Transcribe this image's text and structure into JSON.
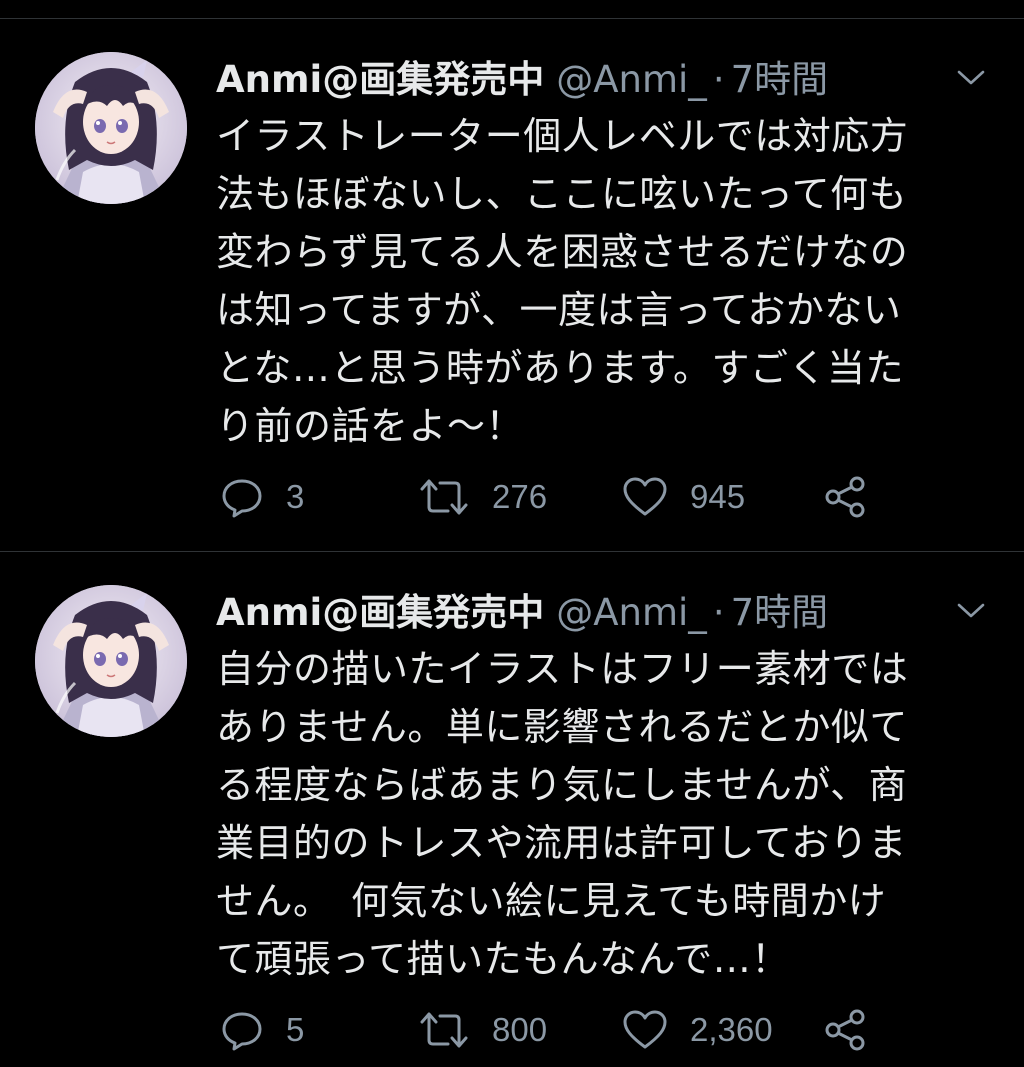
{
  "colors": {
    "background": "#000000",
    "text": "#e7e9ea",
    "secondary_text": "#8b98a5",
    "divider": "#2f3336"
  },
  "tweets": [
    {
      "display_name": "Anmi@画集発売中",
      "handle": "@Anmi_",
      "separator": "·",
      "time": "7時間",
      "text": "イラストレーター個人レベルでは対応方\n法もほぼないし、ここに呟いたって何も\n変わらず見てる人を困惑させるだけなの\nは知ってますが、一度は言っておかない\nとな…と思う時があります。すごく当た\nり前の話をよ〜！",
      "actions": {
        "reply_icon": "comment-icon",
        "reply_count": "3",
        "retweet_icon": "retweet-icon",
        "retweet_count": "276",
        "like_icon": "heart-icon",
        "like_count": "945",
        "share_icon": "share-icon"
      },
      "menu_icon": "chevron-down-icon",
      "avatar": "avatar-illustration"
    },
    {
      "display_name": "Anmi@画集発売中",
      "handle": "@Anmi_",
      "separator": "·",
      "time": "7時間",
      "text": "自分の描いたイラストはフリー素材では\nありません。単に影響されるだとか似て\nる程度ならばあまり気にしませんが、商\n業目的のトレスや流用は許可しておりま\nせん。　何気ない絵に見えても時間かけ\nて頑張って描いたもんなんで…！",
      "actions": {
        "reply_icon": "comment-icon",
        "reply_count": "5",
        "retweet_icon": "retweet-icon",
        "retweet_count": "800",
        "like_icon": "heart-icon",
        "like_count": "2,360",
        "share_icon": "share-icon"
      },
      "menu_icon": "chevron-down-icon",
      "avatar": "avatar-illustration"
    }
  ]
}
